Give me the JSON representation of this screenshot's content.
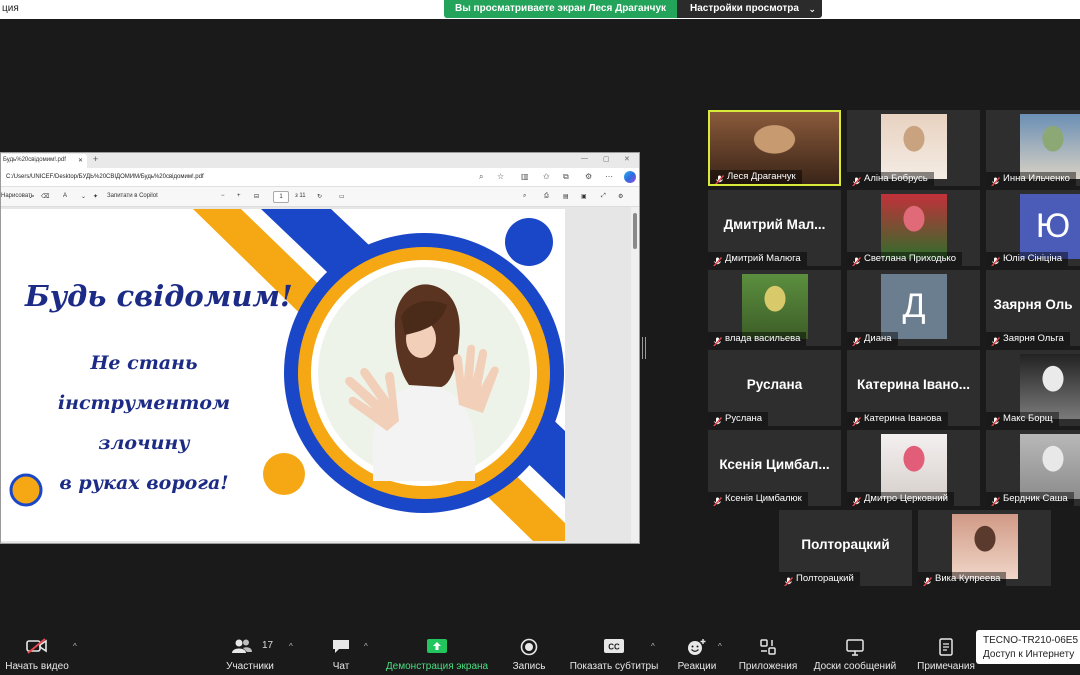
{
  "window": {
    "title_fragment": "ция"
  },
  "share_banner": {
    "text": "Вы просматриваете экран Леся Драганчук",
    "view_options_label": "Настройки просмотра"
  },
  "browser": {
    "tab_title": "Будь%20свідомим!.pdf",
    "url": "C:/Users/UNICEF/Desktop/БУДЬ%20СВІДОМИМ/Будь%20свідомим!.pdf",
    "pdf_toolbar": {
      "draw_label": "Нарисовать",
      "copilot_label": "Запитати в Copilot",
      "zoom_minus": "−",
      "zoom_plus": "+",
      "page_current": "1",
      "page_total": "з 11"
    }
  },
  "slide": {
    "title": "Будь свідомим!",
    "subtitle_lines": [
      "Не стань",
      "інструментом злочину",
      "в руках ворога!"
    ],
    "colors": {
      "navy": "#1c2b86",
      "blue": "#1a47c7",
      "yellow": "#f5a814"
    }
  },
  "participants": [
    {
      "name": "Леся Драганчук",
      "display": "photo",
      "active": true
    },
    {
      "name": "Аліна Бобрусь",
      "display": "photo"
    },
    {
      "name": "Инна Ильченко",
      "display": "photo"
    },
    {
      "name": "Дмитрий Малюга",
      "display": "text",
      "big": "Дмитрий Мал..."
    },
    {
      "name": "Светлана Приходько",
      "display": "photo"
    },
    {
      "name": "Юлія Сініціна",
      "display": "letter",
      "letter": "Ю"
    },
    {
      "name": "влада васильева",
      "display": "photo"
    },
    {
      "name": "Диана",
      "display": "letter",
      "letter": "Д"
    },
    {
      "name": "Заярня Ольга",
      "display": "text",
      "big": "Заярня Оль"
    },
    {
      "name": "Руслана",
      "display": "text",
      "big": "Руслана"
    },
    {
      "name": "Катерина Іванова",
      "display": "text",
      "big": "Катерина Івано..."
    },
    {
      "name": "Макс Борщ",
      "display": "photo"
    },
    {
      "name": "Ксенія Цимбалюк",
      "display": "text",
      "big": "Ксенія Цимбал..."
    },
    {
      "name": "Дмитро Церковний",
      "display": "photo"
    },
    {
      "name": "Бердник Саша",
      "display": "photo"
    },
    {
      "name": "Полторацкий",
      "display": "text",
      "big": "Полторацкий"
    },
    {
      "name": "Вика Купреева",
      "display": "photo"
    }
  ],
  "toolbar": {
    "video": "Начать видео",
    "participants": "Участники",
    "participants_count": "17",
    "chat": "Чат",
    "share": "Демонстрация экрана",
    "record": "Запись",
    "captions": "Показать субтитры",
    "cc_icon_text": "CC",
    "reactions": "Реакции",
    "apps": "Приложения",
    "whiteboards": "Доски сообщений",
    "notes": "Примечания"
  },
  "network": {
    "ssid": "TECNO-TR210-06E5",
    "status": "Доступ к Интернету"
  }
}
